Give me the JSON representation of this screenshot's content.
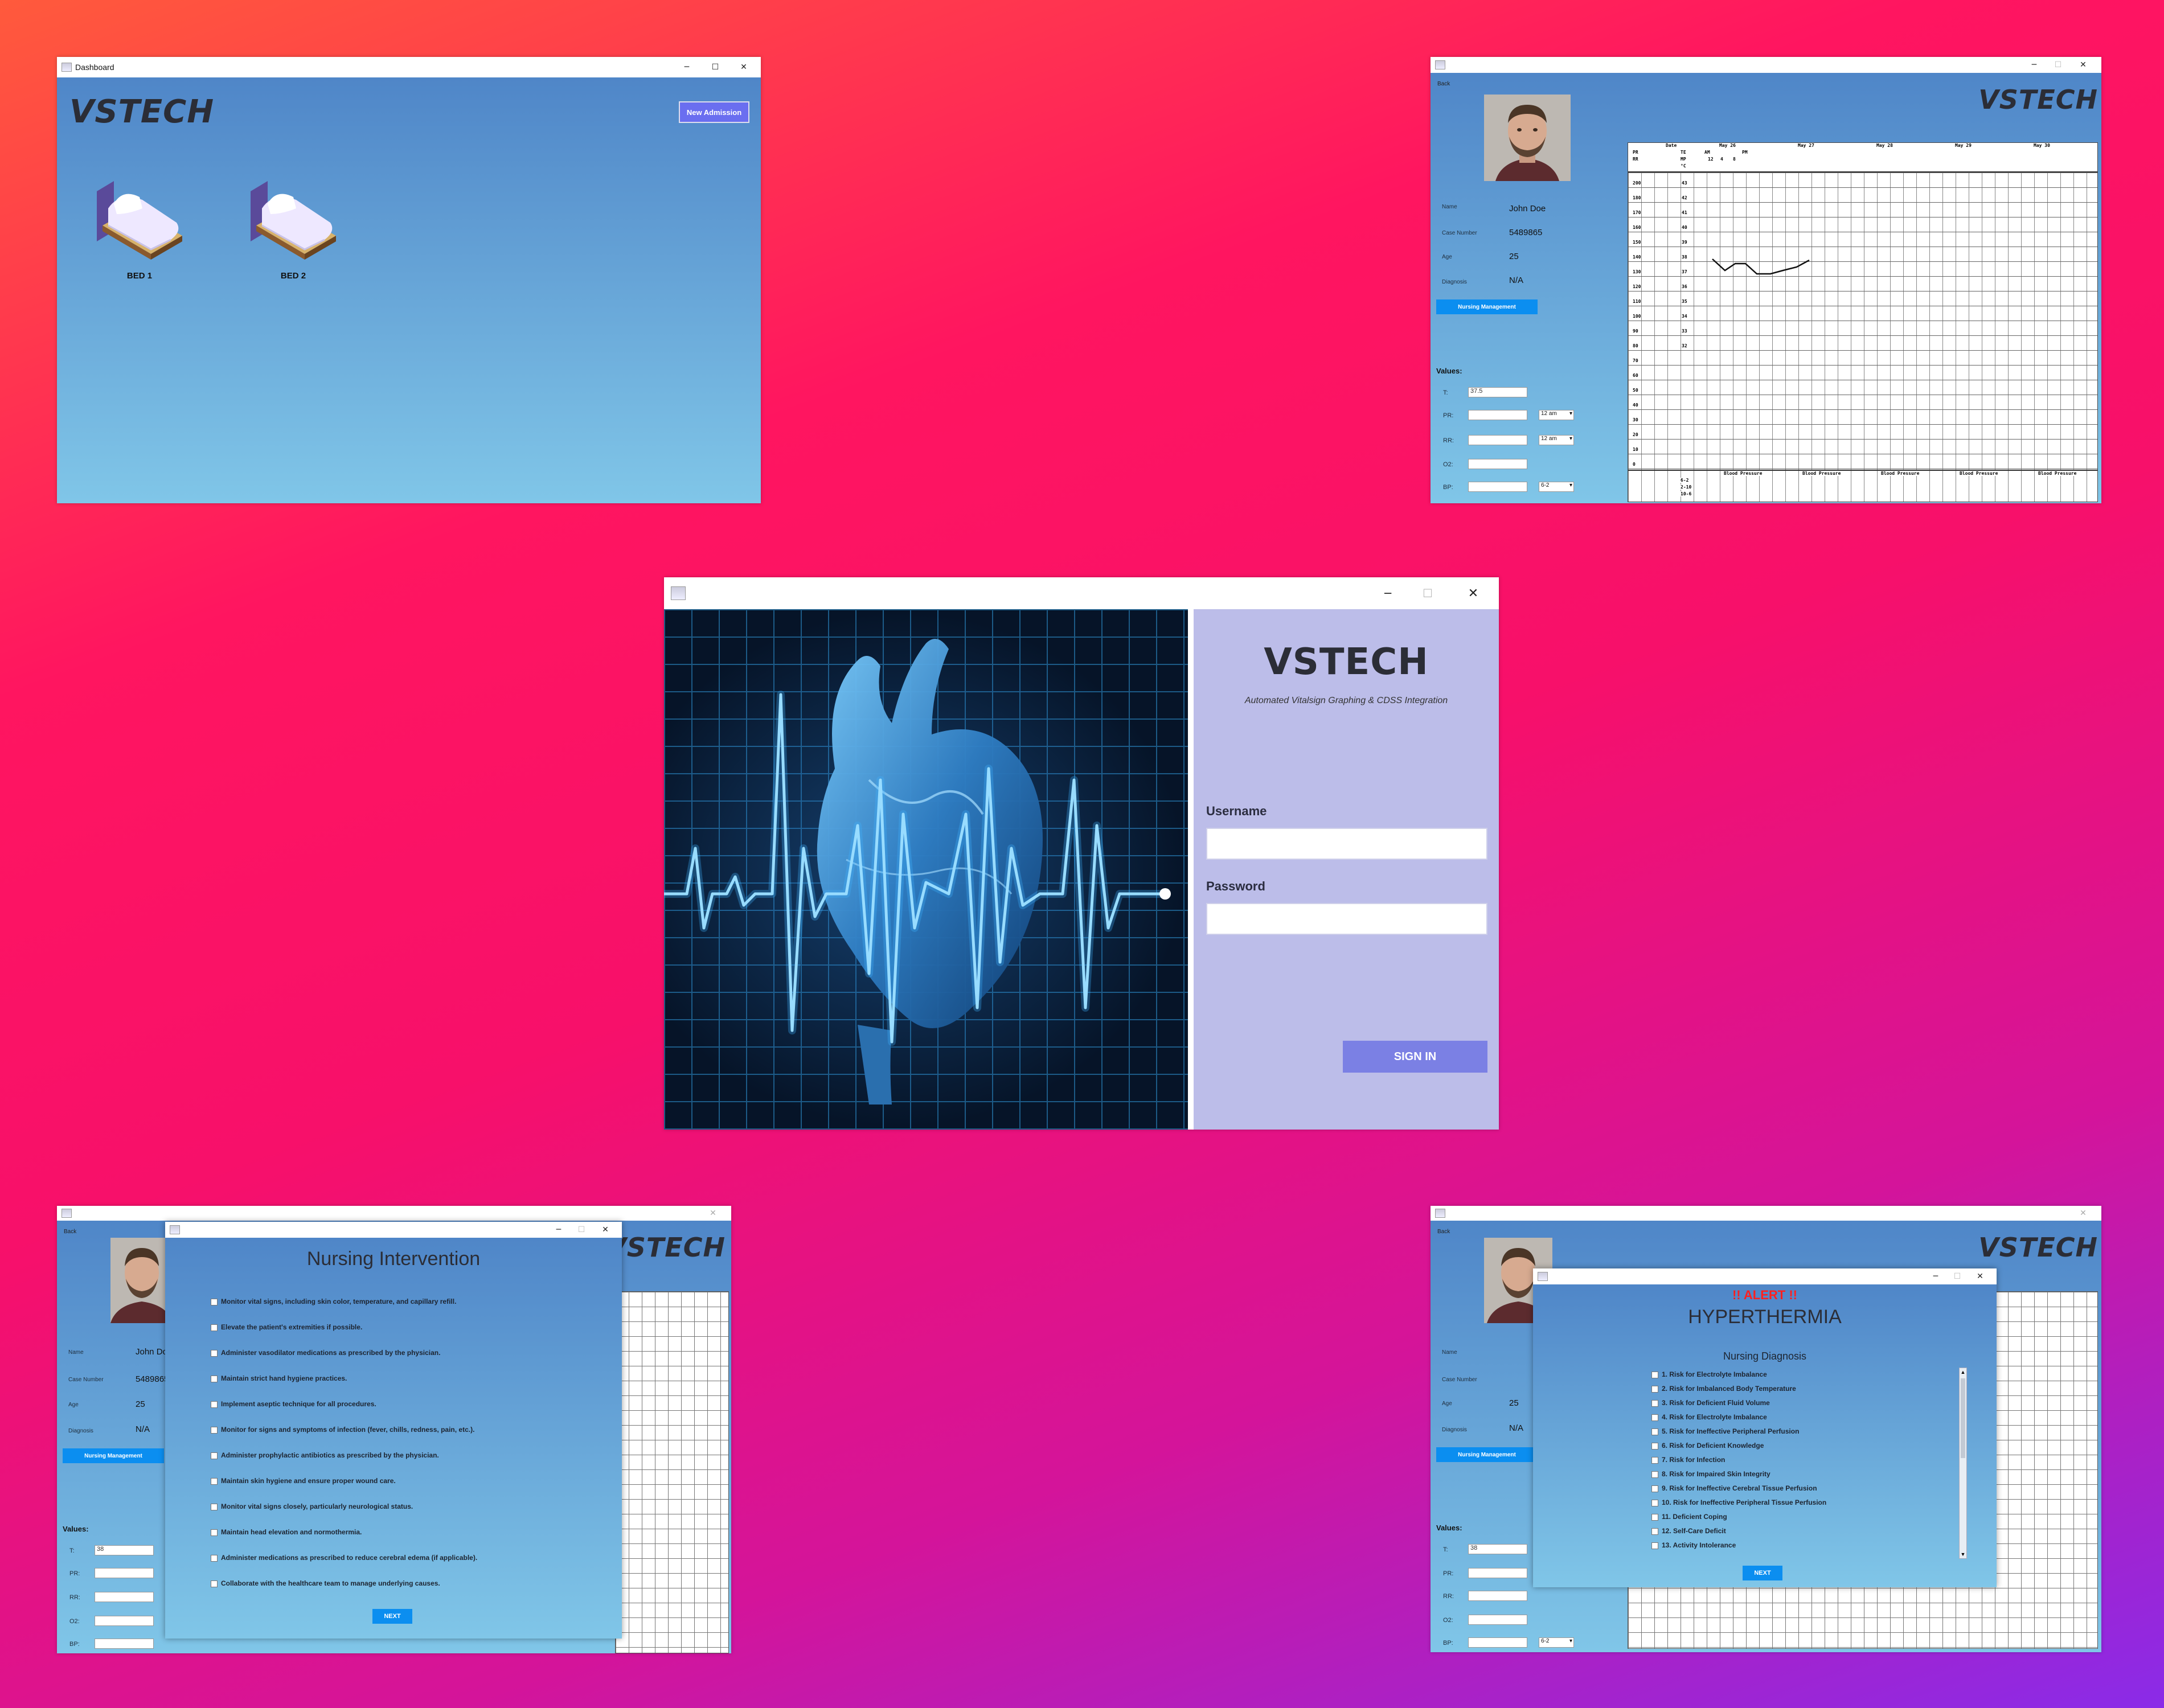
{
  "dashboard": {
    "title": "Dashboard",
    "brand": "VSTECH",
    "new_admission": "New Admission",
    "beds": [
      {
        "label": "BED 1"
      },
      {
        "label": "BED 2"
      }
    ]
  },
  "login": {
    "brand": "VSTECH",
    "tagline": "Automated Vitalsign Graphing & CDSS Integration",
    "username_label": "Username",
    "password_label": "Password",
    "username_value": "",
    "password_value": "",
    "sign_in": "SIGN IN"
  },
  "patient": {
    "back": "Back",
    "brand": "VSTECH",
    "name_label": "Name",
    "name": "John Doe",
    "case_label": "Case Number",
    "case_number": "5489865",
    "age_label": "Age",
    "age": "25",
    "diagnosis_label": "Diagnosis",
    "diagnosis": "N/A",
    "nursing_management": "Nursing Management",
    "values_label": "Values:",
    "fields": {
      "t": "T:",
      "pr": "PR:",
      "rr": "RR:",
      "o2": "O2:",
      "bp": "BP:"
    },
    "t_value": "37.5",
    "t_value_2": "38",
    "pr_time": "12 am",
    "rr_time": "12 am",
    "bp_time": "6-2",
    "chart_header": {
      "date": "Date",
      "pr": "PR",
      "rr": "RR",
      "te": "TE",
      "mp": "MP",
      "deg": "°C",
      "days": [
        "May 26",
        "May 27",
        "May 28",
        "May 29",
        "May 30"
      ],
      "am": "AM",
      "pm": "PM",
      "slots": [
        "12",
        "4",
        "8"
      ]
    },
    "pr_scale": [
      "200",
      "180",
      "170",
      "160",
      "150",
      "140",
      "130",
      "120",
      "110",
      "100",
      "90",
      "80",
      "70",
      "60",
      "50",
      "40",
      "30",
      "20",
      "10",
      "0"
    ],
    "temp_scale": [
      "43",
      "42",
      "41",
      "40",
      "39",
      "38",
      "37",
      "36",
      "35",
      "34",
      "33",
      "32"
    ],
    "blood_pressure": "Blood Pressure",
    "shifts": [
      "6-2",
      "2-10",
      "10-6"
    ]
  },
  "intervention": {
    "title": "Nursing Intervention",
    "items": [
      "Monitor vital signs, including skin color, temperature, and capillary refill.",
      "Elevate the patient's extremities if possible.",
      "Administer vasodilator medications as prescribed by the physician.",
      "Maintain strict hand hygiene practices.",
      "Implement aseptic technique for all procedures.",
      "Monitor for signs and symptoms of infection (fever, chills, redness, pain, etc.).",
      "Administer prophylactic antibiotics as prescribed by the physician.",
      "Maintain skin hygiene and ensure proper wound care.",
      "Monitor vital signs closely, particularly neurological status.",
      "Maintain head elevation and normothermia.",
      "Administer medications as prescribed to reduce cerebral edema (if applicable).",
      "Collaborate with the healthcare team to manage underlying causes."
    ],
    "next": "NEXT"
  },
  "alert": {
    "alert_text": "!! ALERT !!",
    "condition": "HYPERTHERMIA",
    "section": "Nursing Diagnosis",
    "items": [
      "1. Risk for Electrolyte Imbalance",
      "2. Risk for Imbalanced Body Temperature",
      "3. Risk for Deficient Fluid Volume",
      "4. Risk for Electrolyte Imbalance",
      "5. Risk for Ineffective Peripheral Perfusion",
      "6. Risk for Deficient Knowledge",
      "7. Risk for Infection",
      "8. Risk for Impaired Skin Integrity",
      "9. Risk for Ineffective Cerebral Tissue Perfusion",
      "10. Risk for Ineffective Peripheral Tissue Perfusion",
      "11. Deficient Coping",
      "12. Self-Care Deficit",
      "13. Activity Intolerance"
    ],
    "next": "NEXT"
  },
  "colors": {
    "panel_top": "#4f86c8",
    "panel_bottom": "#80c6e8",
    "login_side": "#bcbde9",
    "sign_in": "#7b80e4",
    "accent_blue": "#0b8ef0",
    "alert_red": "#ff2020"
  }
}
